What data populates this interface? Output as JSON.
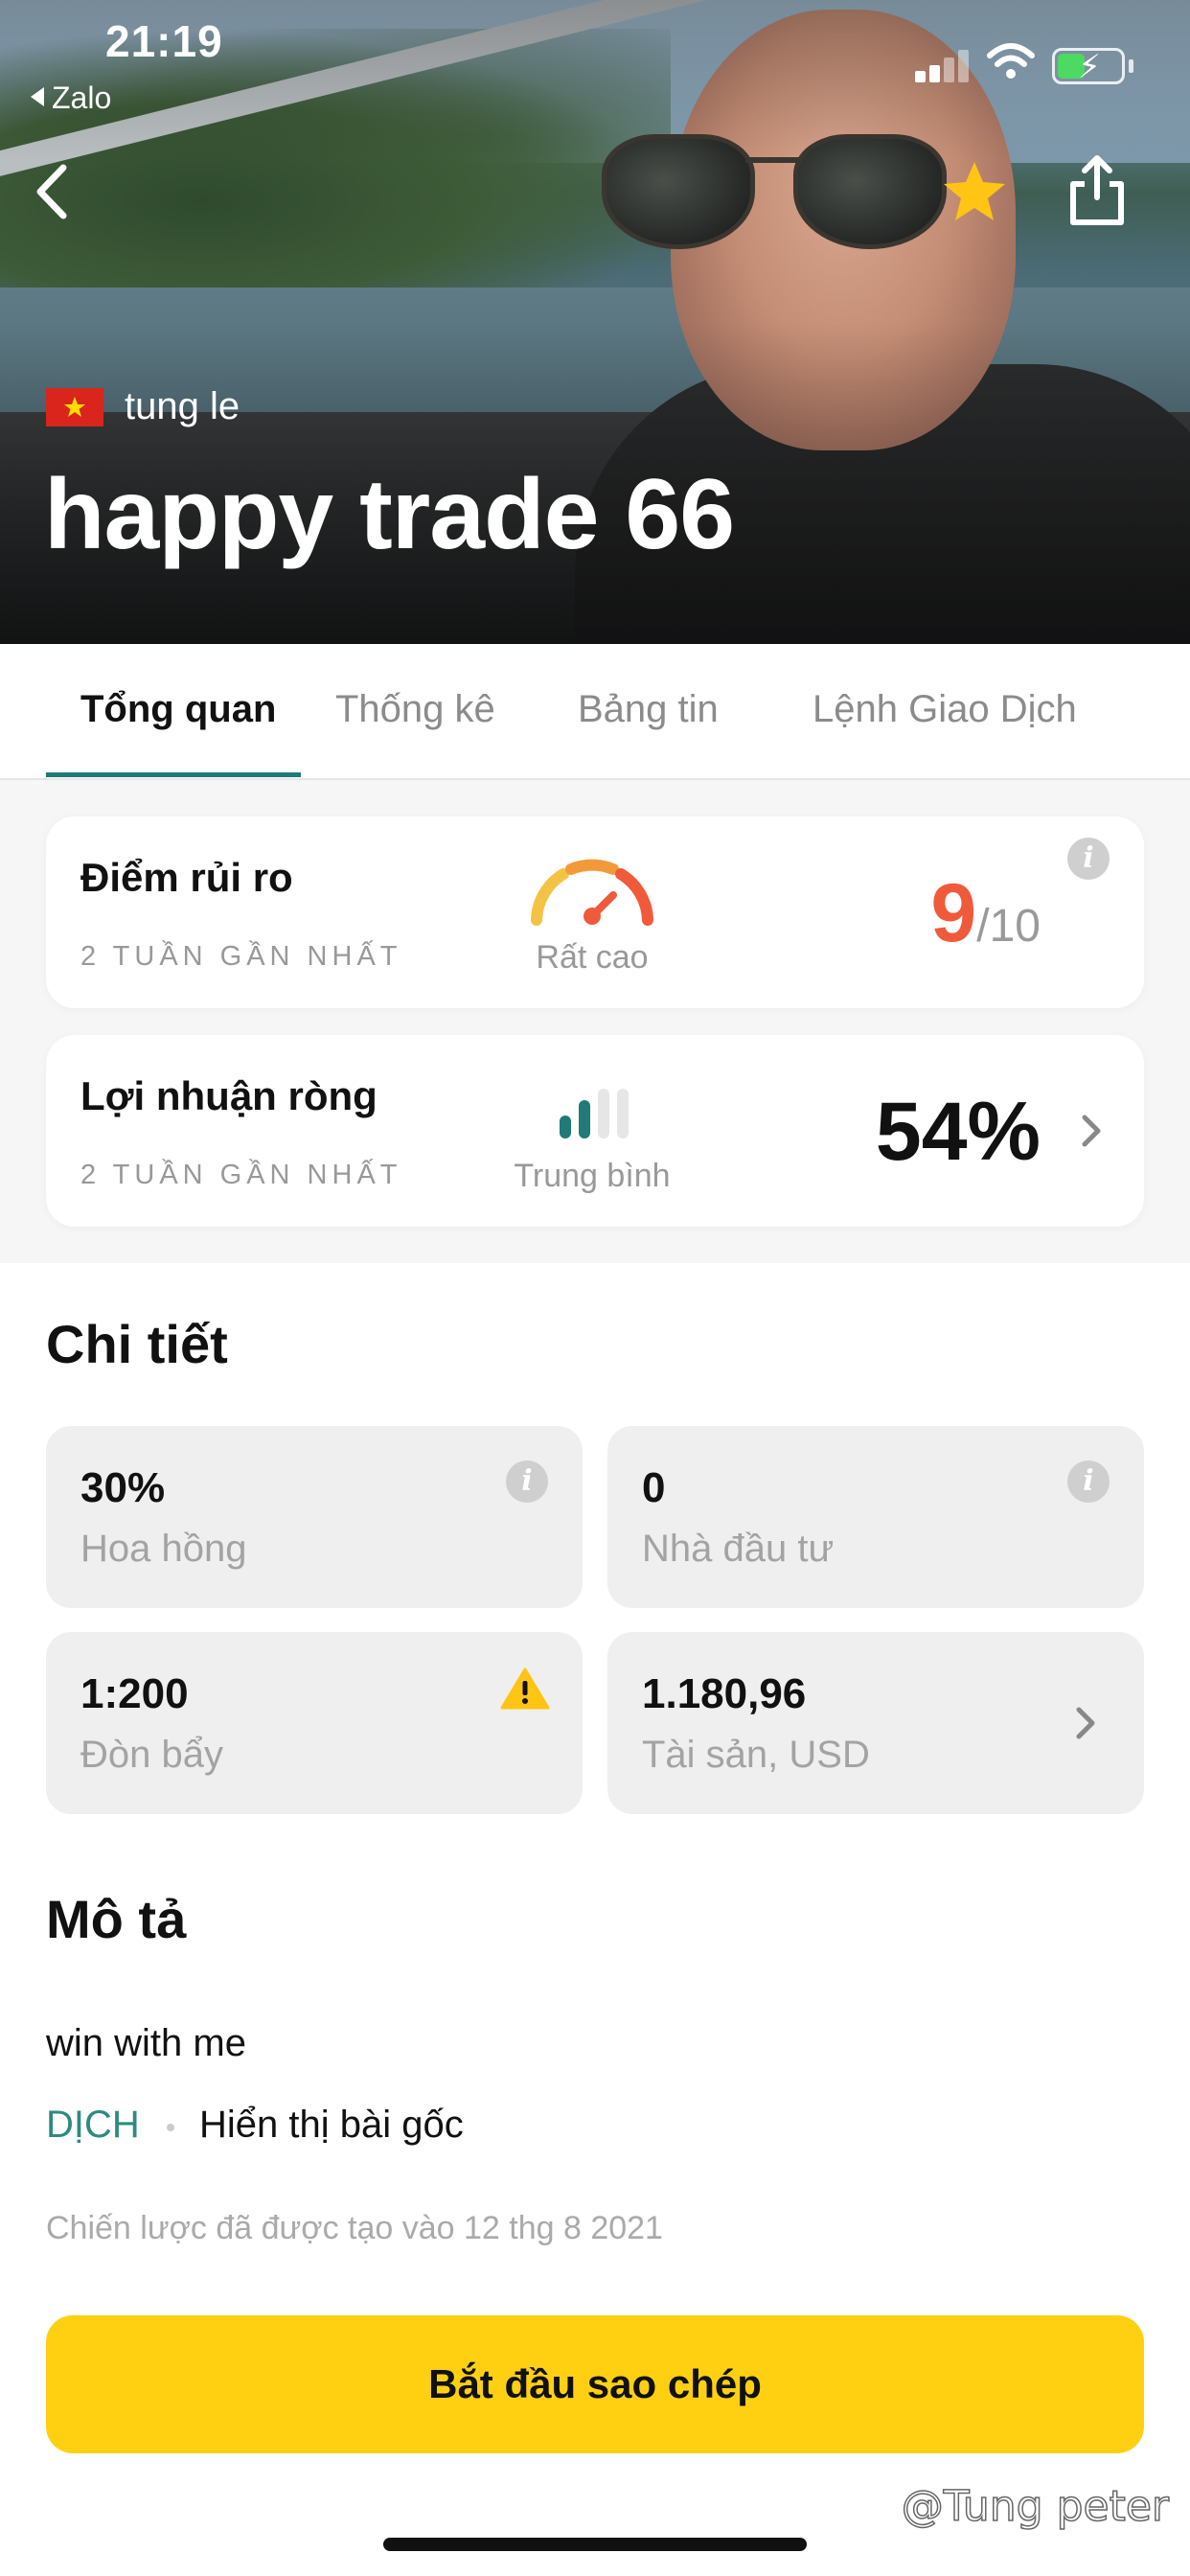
{
  "status_bar": {
    "time": "21:19",
    "back_app": "Zalo"
  },
  "header": {
    "owner_name": "tung le",
    "strategy_name": "happy trade 66",
    "flag": "vietnam-flag-icon"
  },
  "tabs": [
    {
      "label": "Tổng quan",
      "active": true
    },
    {
      "label": "Thống kê",
      "active": false
    },
    {
      "label": "Bảng tin",
      "active": false
    },
    {
      "label": "Lệnh Giao Dịch",
      "active": false
    }
  ],
  "risk_card": {
    "title": "Điểm rủi ro",
    "period": "2 TUẦN GẦN NHẤT",
    "level_label": "Rất cao",
    "score": "9",
    "score_max": "/10"
  },
  "profit_card": {
    "title": "Lợi nhuận ròng",
    "period": "2 TUẦN GẦN NHẤT",
    "level_label": "Trung bình",
    "value": "54%"
  },
  "details": {
    "title": "Chi tiết",
    "tiles": [
      {
        "value": "30%",
        "label": "Hoa hồng",
        "icon": "info-icon"
      },
      {
        "value": "0",
        "label": "Nhà đầu tư",
        "icon": "info-icon"
      },
      {
        "value": "1:200",
        "label": "Đòn bẩy",
        "icon": "warning-icon"
      },
      {
        "value": "1.180,96",
        "label": "Tài sản, USD",
        "icon": "chevron-right-icon"
      }
    ]
  },
  "description": {
    "title": "Mô tả",
    "text": "win with me",
    "translate_label": "DỊCH",
    "show_original_label": "Hiển thị bài gốc",
    "created_text": "Chiến lược đã được tạo vào 12 thg 8 2021"
  },
  "cta": {
    "label": "Bắt đầu sao chép"
  },
  "watermark": "@Tung peter",
  "colors": {
    "accent": "#1f7a78",
    "risk": "#ef5a3a",
    "cta": "#ffd012",
    "star": "#ffc414"
  }
}
